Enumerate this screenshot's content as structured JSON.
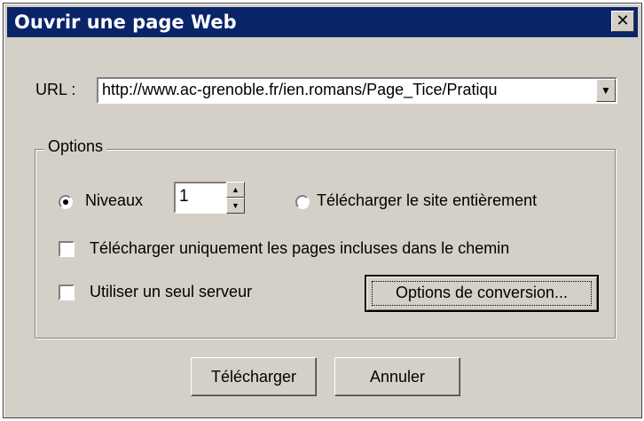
{
  "window": {
    "title": "Ouvrir une page Web",
    "close_glyph": "✕"
  },
  "url": {
    "label": "URL :",
    "value": "http://www.ac-grenoble.fr/ien.romans/Page_Tice/Pratiqu"
  },
  "options": {
    "group_title": "Options",
    "levels": {
      "label": "Niveaux",
      "value": "1",
      "selected": true
    },
    "whole_site": {
      "label": "Télécharger le site entièrement",
      "selected": false
    },
    "path_only": {
      "label": "Télécharger uniquement les pages incluses dans le chemin",
      "checked": false
    },
    "single_server": {
      "label": "Utiliser un seul serveur",
      "checked": false
    },
    "conversion_button": "Options de conversion..."
  },
  "buttons": {
    "download": "Télécharger",
    "cancel": "Annuler"
  }
}
